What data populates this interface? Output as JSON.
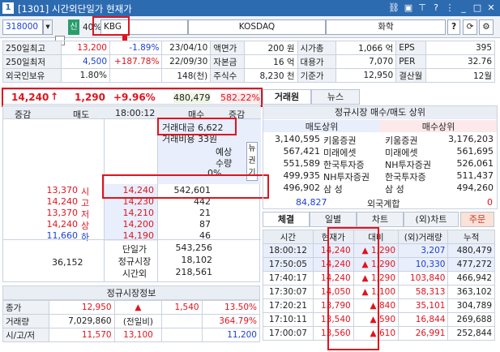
{
  "window": {
    "num": "1",
    "title": "[1301] 시간외단일가 현재가"
  },
  "toolbar": {
    "code": "318000",
    "sin": "신",
    "pct": "40%",
    "name": "KBG",
    "market": "KOSDAQ",
    "sector": "화학",
    "q": "?"
  },
  "info": {
    "rows": [
      {
        "l1": "250일최고",
        "v1": "13,200",
        "p1": "-1.89%",
        "d1": "23/04/10",
        "l2": "액면가",
        "v2": "200 원",
        "l3": "시가총",
        "v3": "1,066 억",
        "l4": "EPS",
        "v4": "395"
      },
      {
        "l1": "250일최저",
        "v1": "4,500",
        "p1": "+187.78%",
        "d1": "22/09/30",
        "l2": "자본금",
        "v2": "16 억",
        "l3": "대용가",
        "v3": "7,070",
        "l4": "PER",
        "v4": "32.76"
      },
      {
        "l1": "외국인보유",
        "v1": "1.80%",
        "p1": "",
        "d1": "148(천)",
        "l2": "주식수",
        "v2": "8,230 천",
        "l3": "기준가",
        "v3": "12,950",
        "l4": "결산월",
        "v4": "12월"
      }
    ]
  },
  "price": {
    "cur": "14,240",
    "arrow": "↑",
    "chg": "1,290",
    "pct": "+9.96%",
    "vol": "480,479",
    "rate": "582.22%"
  },
  "tabs_top": [
    "거래원",
    "뉴스"
  ],
  "orderbook": {
    "headers": [
      "증감",
      "매도",
      "18:00:12",
      "매수",
      "증감"
    ],
    "trade_amt": "거래대금 6,622",
    "trade_cost": "거래비용 33원",
    "est_label": "예상",
    "qty_label": "수량",
    "zero": "0%",
    "side": [
      "뉴",
      "권",
      "기"
    ],
    "asks": [
      {
        "chg": "13,370",
        "tag": "시",
        "price": "14,240",
        "qty": "542,601"
      },
      {
        "chg": "14,240",
        "tag": "고",
        "price": "14,230",
        "qty": "442"
      },
      {
        "chg": "13,370",
        "tag": "저",
        "price": "14,210",
        "qty": "21"
      },
      {
        "chg": "14,240",
        "tag": "상",
        "price": "14,200",
        "qty": "87"
      },
      {
        "chg": "11,660",
        "tag": "하",
        "price": "14,190",
        "qty": "46"
      }
    ],
    "bottom_left": "36,152",
    "bottom_rows": [
      {
        "k": "단일가",
        "v": "543,256"
      },
      {
        "k": "정규시장",
        "v": "18,102"
      },
      {
        "k": "시간외",
        "v": "218,561"
      }
    ]
  },
  "broker": {
    "title": "정규시장 매수/매도 상위",
    "sell_h": "매도상위",
    "buy_h": "매수상위",
    "rows": [
      {
        "sv": "3,140,595",
        "sn": "키움증권",
        "bn": "키움증권",
        "bv": "3,176,203"
      },
      {
        "sv": "567,421",
        "sn": "미래에셋",
        "bn": "미래에셋",
        "bv": "561,695"
      },
      {
        "sv": "551,589",
        "sn": "한국투자증",
        "bn": "NH투자증권",
        "bv": "526,061"
      },
      {
        "sv": "499,935",
        "sn": "NH투자증권",
        "bn": "한국투자증",
        "bv": "511,437"
      },
      {
        "sv": "496,902",
        "sn": "삼 성",
        "bn": "삼 성",
        "bv": "494,260"
      }
    ],
    "foreign": {
      "v": "84,827",
      "k": "외국계합",
      "b": "0"
    }
  },
  "tabs_mid": [
    "체결",
    "일별",
    "차트",
    "(외)차트",
    "주문"
  ],
  "ticks": {
    "headers": [
      "시간",
      "현재가",
      "대비",
      "(외)거래량",
      "누적"
    ],
    "rows": [
      {
        "t": "18:00:12",
        "p": "14,240",
        "c": "1,290",
        "v": "3,207",
        "s": "480,479"
      },
      {
        "t": "17:50:05",
        "p": "14,240",
        "c": "1,290",
        "v": "10,330",
        "s": "477,272"
      },
      {
        "t": "17:40:17",
        "p": "14,240",
        "c": "1,290",
        "v": "103,840",
        "s": "466,942"
      },
      {
        "t": "17:30:07",
        "p": "14,050",
        "c": "1,100",
        "v": "58,313",
        "s": "363,102"
      },
      {
        "t": "17:20:21",
        "p": "13,790",
        "c": "840",
        "v": "35,101",
        "s": "304,789"
      },
      {
        "t": "17:10:11",
        "p": "13,540",
        "c": "590",
        "v": "16,844",
        "s": "269,688"
      },
      {
        "t": "17:00:07",
        "p": "13,560",
        "c": "610",
        "v": "26,991",
        "s": "252,844"
      }
    ]
  },
  "regular": {
    "title": "정규시장정보",
    "rows": [
      {
        "k": "종가",
        "a": "12,950",
        "b": "▲",
        "c": "1,540",
        "d": "13.50%"
      },
      {
        "k": "거래량",
        "a": "7,029,860",
        "b": "(전일비)",
        "c": "",
        "d": "364.79%"
      },
      {
        "k": "시/고/저",
        "a": "11,570",
        "b": "13,100",
        "c": "",
        "d": "11,200"
      }
    ]
  },
  "colors": {
    "accent": "#2d6bb1",
    "up": "#e0141e",
    "down": "#1c3fd6"
  }
}
